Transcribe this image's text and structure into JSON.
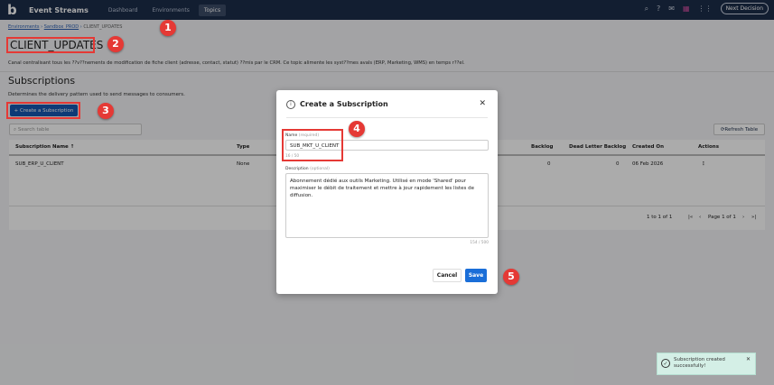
{
  "nav": {
    "brand": "Event Streams",
    "links": [
      "Dashboard",
      "Environments",
      "Topics"
    ],
    "active": "Topics",
    "next_decision": "Next Decision"
  },
  "breadcrumb": [
    "Environments",
    "Sandbox_PROD",
    "CLIENT_UPDATES"
  ],
  "topic": {
    "title": "CLIENT_UPDATES",
    "description": "Canal centralisant tous les ??v??nements de modification de fiche client (adresse, contact, statut) ??mis par le CRM. Ce topic alimente les syst??mes avals (ERP, Marketing, WMS) en temps r??el."
  },
  "subscriptions": {
    "heading": "Subscriptions",
    "subtitle": "Determines the delivery pattern used to send messages to consumers.",
    "create_label": "+ Create a Subscription",
    "search_placeholder": "Search table",
    "refresh_label": "Refresh Table",
    "columns": [
      "Subscription Name ↑",
      "Type",
      "Backlog",
      "Dead Letter Backlog",
      "Created On",
      "Actions"
    ],
    "rows": [
      {
        "name": "SUB_ERP_U_CLIENT",
        "type": "None",
        "backlog": "0",
        "dlq": "0",
        "created": "06 Feb 2026"
      }
    ],
    "pagination": {
      "range": "1 to 1 of 1",
      "page": "Page 1 of 1"
    }
  },
  "modal": {
    "title": "Create a Subscription",
    "name_label": "Name",
    "name_hint": "(required)",
    "name_value": "SUB_MKT_U_CLIENT",
    "name_count": "16 / 50",
    "desc_label": "Description",
    "desc_hint": "(optional)",
    "desc_value": "Abonnement dédié aux outils Marketing. Utilisé en mode 'Shared' pour maximiser le débit de traitement et mettre à jour rapidement les listes de diffusion.",
    "desc_count": "154 / 500",
    "cancel": "Cancel",
    "save": "Save"
  },
  "toast": {
    "message": "Subscription created successfully!"
  },
  "annotations": [
    "1",
    "2",
    "3",
    "4",
    "5"
  ],
  "colors": {
    "nav": "#1c2d4a",
    "primary": "#1557b0",
    "annotation": "#e53935",
    "toast": "#d4efe6"
  }
}
